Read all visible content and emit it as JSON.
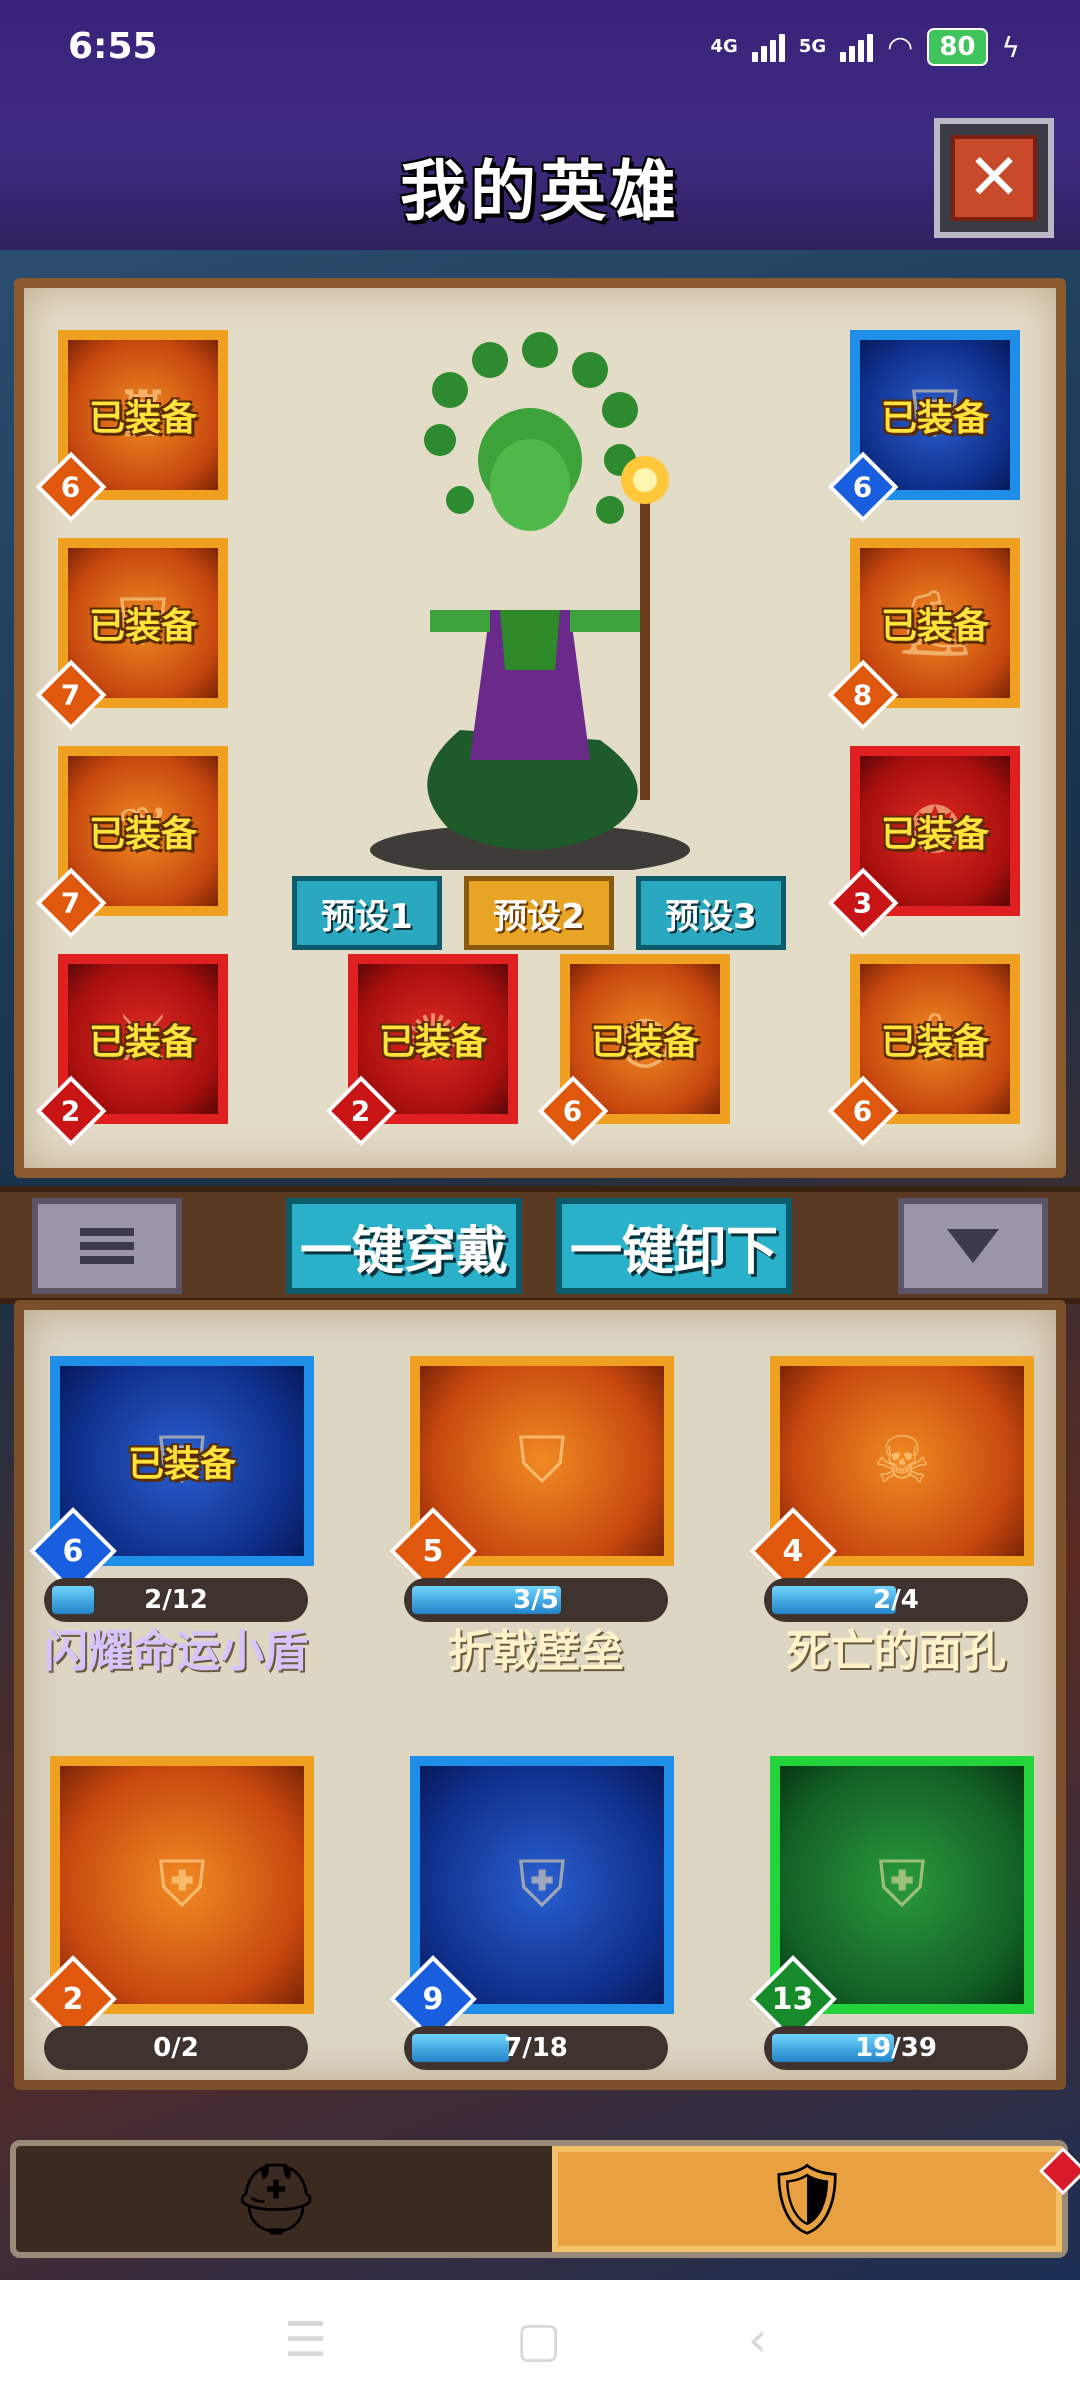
{
  "status_bar": {
    "time": "6:55",
    "network1": "4G",
    "network2": "5G",
    "battery": "80"
  },
  "header": {
    "title": "我的英雄"
  },
  "colors": {
    "header_bg": "#3f2a82",
    "equipped_text": "#ffe23a",
    "teal_button": "#2ab0c8",
    "gold_button": "#e8a424"
  },
  "equipment_slots": [
    {
      "id": "head",
      "label": "已装备",
      "level": "6",
      "rarity": "orange",
      "icon": "helmet-icon"
    },
    {
      "id": "shoulders",
      "label": "已装备",
      "level": "7",
      "rarity": "orange",
      "icon": "shoulder-armor-icon"
    },
    {
      "id": "cloak",
      "label": "已装备",
      "level": "7",
      "rarity": "orange",
      "icon": "cloak-icon"
    },
    {
      "id": "weapon",
      "label": "已装备",
      "level": "2",
      "rarity": "red",
      "icon": "sword-icon"
    },
    {
      "id": "offhand",
      "label": "已装备",
      "level": "6",
      "rarity": "blue",
      "icon": "shield-icon"
    },
    {
      "id": "boots",
      "label": "已装备",
      "level": "8",
      "rarity": "orange",
      "icon": "boots-icon"
    },
    {
      "id": "pet",
      "label": "已装备",
      "level": "3",
      "rarity": "red",
      "icon": "phoenix-icon"
    },
    {
      "id": "necklace",
      "label": "已装备",
      "level": "6",
      "rarity": "orange",
      "icon": "amulet-icon"
    },
    {
      "id": "relic",
      "label": "已装备",
      "level": "2",
      "rarity": "red",
      "icon": "tentacle-relic-icon"
    },
    {
      "id": "ring",
      "label": "已装备",
      "level": "6",
      "rarity": "orange",
      "icon": "ring-icon"
    }
  ],
  "presets": [
    "预设1",
    "预设2",
    "预设3"
  ],
  "toolbar": {
    "equip_all": "一键穿戴",
    "unequip_all": "一键卸下"
  },
  "inventory": [
    {
      "name": "闪耀命运小盾",
      "equipped_label": "已装备",
      "level": "6",
      "rarity": "blue",
      "progress": "2/12",
      "fraction": 0.17,
      "icon": "shield-icon"
    },
    {
      "name": "折戟壁垒",
      "equipped_label": "",
      "level": "5",
      "rarity": "orange",
      "progress": "3/5",
      "fraction": 0.6,
      "icon": "bulwark-icon"
    },
    {
      "name": "死亡的面孔",
      "equipped_label": "",
      "level": "4",
      "rarity": "orange",
      "progress": "2/4",
      "fraction": 0.5,
      "icon": "skull-icon"
    },
    {
      "name": "",
      "equipped_label": "",
      "level": "2",
      "rarity": "orange",
      "progress": "0/2",
      "fraction": 0,
      "icon": "dragon-shield-icon"
    },
    {
      "name": "",
      "equipped_label": "",
      "level": "9",
      "rarity": "blue",
      "progress": "7/18",
      "fraction": 0.39,
      "icon": "crystal-shield-icon"
    },
    {
      "name": "",
      "equipped_label": "",
      "level": "13",
      "rarity": "green",
      "progress": "19/39",
      "fraction": 0.49,
      "icon": "emerald-shield-icon"
    }
  ],
  "tabs": [
    {
      "id": "heroes",
      "icon": "viking-helmet-icon",
      "active": false
    },
    {
      "id": "equipment",
      "icon": "chest-armor-icon",
      "active": true
    }
  ]
}
